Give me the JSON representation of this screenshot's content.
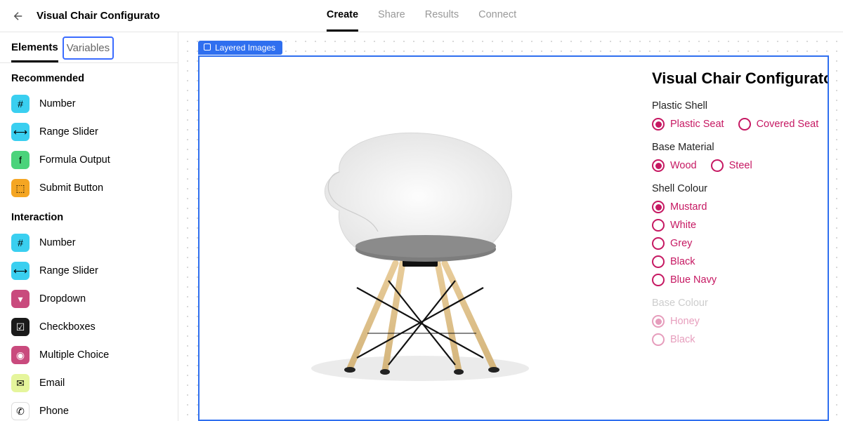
{
  "header": {
    "back_icon": "←",
    "title": "Visual Chair Configurato",
    "tabs": [
      {
        "label": "Create",
        "active": true
      },
      {
        "label": "Share"
      },
      {
        "label": "Results"
      },
      {
        "label": "Connect"
      }
    ]
  },
  "sidebar": {
    "tabs": [
      {
        "label": "Elements",
        "active": true
      },
      {
        "label": "Variables",
        "highlight": true
      }
    ],
    "sections": [
      {
        "title": "Recommended",
        "items": [
          {
            "icon": "#",
            "color": "blue",
            "label": "Number"
          },
          {
            "icon": "⟷",
            "color": "blue",
            "label": "Range Slider"
          },
          {
            "icon": "f",
            "color": "green",
            "label": "Formula Output"
          },
          {
            "icon": "⬚",
            "color": "orange",
            "label": "Submit Button"
          }
        ]
      },
      {
        "title": "Interaction",
        "items": [
          {
            "icon": "#",
            "color": "blue",
            "label": "Number"
          },
          {
            "icon": "⟷",
            "color": "blue",
            "label": "Range Slider"
          },
          {
            "icon": "▾",
            "color": "pink",
            "label": "Dropdown"
          },
          {
            "icon": "☑",
            "color": "black",
            "label": "Checkboxes"
          },
          {
            "icon": "◉",
            "color": "pink",
            "label": "Multiple Choice"
          },
          {
            "icon": "✉",
            "color": "lime",
            "label": "Email"
          },
          {
            "icon": "✆",
            "color": "white",
            "label": "Phone"
          }
        ]
      }
    ]
  },
  "canvas": {
    "frame_label": "Layered Images"
  },
  "configurator": {
    "title": "Visual Chair Configurator",
    "groups": [
      {
        "title": "Plastic Shell",
        "layout": "h",
        "options": [
          {
            "label": "Plastic Seat",
            "checked": true
          },
          {
            "label": "Covered Seat"
          }
        ]
      },
      {
        "title": "Base Material",
        "layout": "h",
        "options": [
          {
            "label": "Wood",
            "checked": true
          },
          {
            "label": "Steel"
          }
        ]
      },
      {
        "title": "Shell Colour",
        "layout": "v",
        "options": [
          {
            "label": "Mustard",
            "checked": true
          },
          {
            "label": "White"
          },
          {
            "label": "Grey"
          },
          {
            "label": "Black"
          },
          {
            "label": "Blue Navy"
          }
        ]
      },
      {
        "title": "Base Colour",
        "layout": "v",
        "dim": true,
        "options": [
          {
            "label": "Honey",
            "checked": true
          },
          {
            "label": "Black"
          }
        ]
      }
    ]
  },
  "colors": {
    "accent": "#c61862",
    "selection": "#2f6fef"
  }
}
